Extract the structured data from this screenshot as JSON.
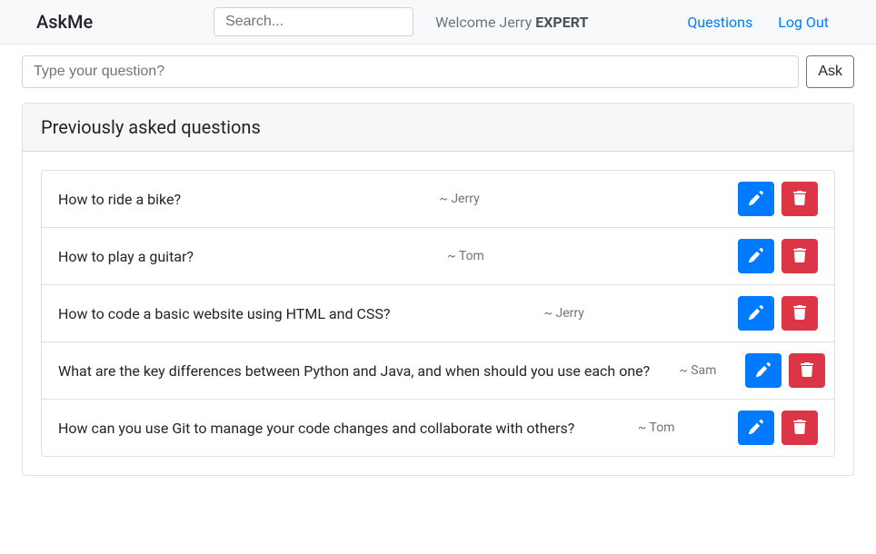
{
  "header": {
    "brand": "AskMe",
    "search_placeholder": "Search...",
    "welcome_prefix": "Welcome ",
    "welcome_name": "Jerry",
    "welcome_role": "EXPERT",
    "nav": {
      "questions": "Questions",
      "logout": "Log Out"
    }
  },
  "ask": {
    "placeholder": "Type your question?",
    "button": "Ask"
  },
  "panel": {
    "title": "Previously asked questions"
  },
  "questions": [
    {
      "text": "How to ride a bike?",
      "author": "~ Jerry"
    },
    {
      "text": "How to play a guitar?",
      "author": "~ Tom"
    },
    {
      "text": "How to code a basic website using HTML and CSS?",
      "author": "~ Jerry"
    },
    {
      "text": "What are the key differences between Python and Java, and when should you use each one?",
      "author": "~ Sam"
    },
    {
      "text": "How can you use Git to manage your code changes and collaborate with others?",
      "author": "~ Tom"
    }
  ],
  "icons": {
    "edit": "edit-icon",
    "delete": "trash-icon"
  }
}
